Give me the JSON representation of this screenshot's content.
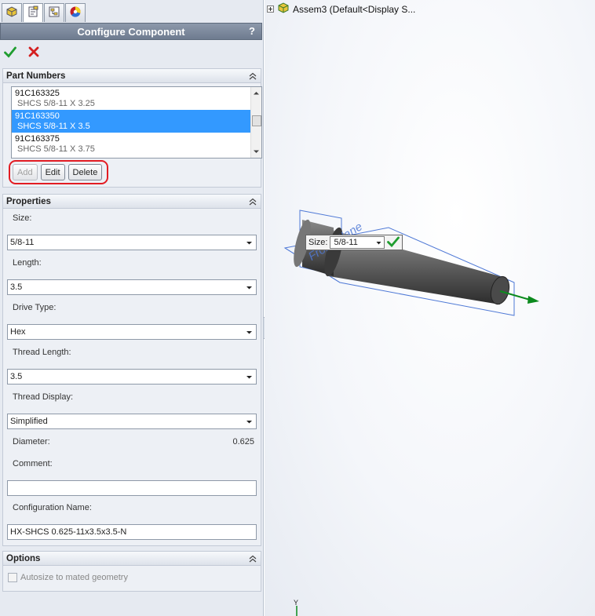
{
  "panel": {
    "title": "Configure Component",
    "help": "?",
    "tabs": [
      "feature-manager",
      "property-manager",
      "configuration-manager",
      "appearance-manager"
    ]
  },
  "part_numbers": {
    "header": "Part Numbers",
    "items": [
      {
        "pn": "91C163325",
        "desc": "SHCS 5/8-11 X 3.25",
        "selected": false
      },
      {
        "pn": "91C163350",
        "desc": "SHCS 5/8-11 X 3.5",
        "selected": true
      },
      {
        "pn": "91C163375",
        "desc": "SHCS 5/8-11 X 3.75",
        "selected": false
      }
    ],
    "buttons": {
      "add": "Add",
      "edit": "Edit",
      "delete": "Delete"
    }
  },
  "properties": {
    "header": "Properties",
    "size_label": "Size:",
    "size_value": "5/8-11",
    "length_label": "Length:",
    "length_value": "3.5",
    "drive_label": "Drive Type:",
    "drive_value": "Hex",
    "thread_length_label": "Thread Length:",
    "thread_length_value": "3.5",
    "thread_display_label": "Thread Display:",
    "thread_display_value": "Simplified",
    "diameter_label": "Diameter:",
    "diameter_value": "0.625",
    "comment_label": "Comment:",
    "comment_value": "",
    "config_name_label": "Configuration Name:",
    "config_name_value": "HX-SHCS 0.625-11x3.5x3.5-N"
  },
  "options": {
    "header": "Options",
    "autosize_label": "Autosize to mated geometry"
  },
  "viewport": {
    "tree_label": "Assem3  (Default<Display S...",
    "plane_label": "Front Plane",
    "popup_size_label": "Size:",
    "popup_size_value": "5/8-11",
    "triad_label": "Y"
  },
  "colors": {
    "selected": "#3399ff",
    "ok_green": "#1f9d2f",
    "cancel_red": "#d42020",
    "highlight": "#e21c23",
    "plane_blue": "#4f79d6",
    "arrow_green": "#0b8a1d"
  }
}
